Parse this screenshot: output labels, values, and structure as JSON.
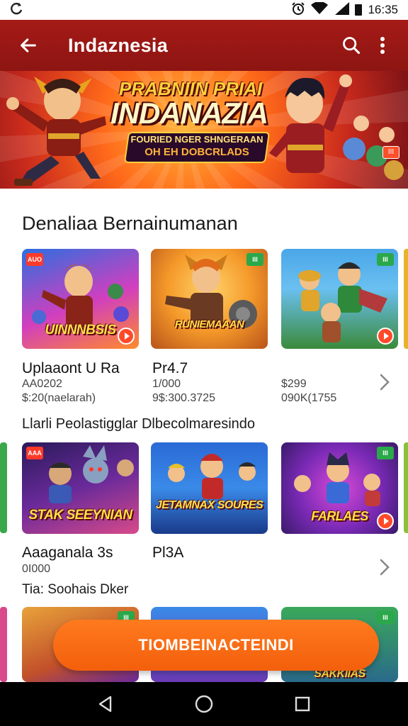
{
  "status_bar": {
    "left_icon": "sync-icon",
    "time": "16:35",
    "icons": [
      "alarm-icon",
      "wifi-icon",
      "signal-icon",
      "battery-icon"
    ]
  },
  "app_bar": {
    "title": "Indaznesia",
    "icons": [
      "back-arrow-icon",
      "search-icon",
      "more-vert-icon"
    ]
  },
  "banner": {
    "line1": "PRABNIIN PRIAI",
    "line2": "INDANAZIA",
    "line3": "FOURIED NGER SHNGERAAN",
    "line4": "OH EH DOBCRLADS",
    "badge": "III"
  },
  "section1": {
    "title": "Denaliaa Bernainumanan",
    "cards": [
      {
        "logo": "UINNNBSIS",
        "badge": "AUO",
        "badge_color": "#ff3a2a"
      },
      {
        "logo": "RUNIEMAAAN",
        "badge": "III",
        "badge_color": "#2aa84a"
      },
      {
        "logo": "",
        "badge": "III",
        "badge_color": "#2aa84a"
      }
    ],
    "games": [
      {
        "name": "Uplaaont U Ra",
        "meta1": "AA0202",
        "meta2": "$:20(naelarah)"
      },
      {
        "name": "Pr4.7",
        "meta1": "1/000",
        "meta2": "9$:300.3725"
      },
      {
        "name": "",
        "meta1": "$299",
        "meta2": "090K(1755"
      }
    ]
  },
  "section2": {
    "title": "Llarli Peolastigglar Dlbecolmaresindo",
    "cards": [
      {
        "logo": "STAK SEEYNIAN",
        "badge": "AAA",
        "badge_color": "#ff3a2a"
      },
      {
        "logo": "JETAMNAX SOURES",
        "badge": "",
        "badge_color": ""
      },
      {
        "logo": "FARLAES",
        "badge": "III",
        "badge_color": "#2aa84a"
      }
    ],
    "games": [
      {
        "name": "Aaaganala 3s",
        "meta1": "0I000"
      },
      {
        "name": "Pl3A",
        "meta1": ""
      }
    ],
    "footer": "Tia: Soohais Dker"
  },
  "section3": {
    "cards": [
      {
        "badge": "III",
        "badge_color": "#2aa84a"
      },
      {
        "badge": "",
        "badge_color": ""
      },
      {
        "badge": "III",
        "badge_color": "#2aa84a"
      }
    ],
    "partial_text": "SAKKIIAS"
  },
  "cta": {
    "label": "TIOMBEINACTEINDI"
  },
  "nav": {
    "icons": [
      "back-triangle-icon",
      "home-circle-icon",
      "recents-square-icon"
    ]
  },
  "colors": {
    "app_bar": "#9a1815",
    "accent_orange": "#f36a14",
    "badge_red": "#ff3a2a",
    "badge_green": "#2aa84a"
  }
}
